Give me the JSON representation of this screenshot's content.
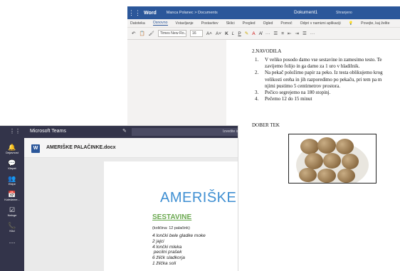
{
  "word": {
    "app_name": "Word",
    "breadcrumb": "Manca Polanec > Documents",
    "doc_title": "Dokument1",
    "save_state": "Shranjeno",
    "tabs": [
      "Datoteka",
      "Osnovno",
      "Vstavljanje",
      "Postavitev",
      "Sklici",
      "Pregled",
      "Ogled",
      "Pomoč",
      "Odpri v namizni aplikaciji",
      "Povejte, kaj želite"
    ],
    "active_tab": "Osnovno",
    "font_name": "Times New Ro...",
    "font_size": "16",
    "section_heading": "2.NAVODILA",
    "steps": [
      {
        "num": "1.",
        "line1": "V veliko posodo damo vse sestavine in zamesimo testo. Te",
        "line2": "zavijemo folijo in ga damo za 1 uro v hladilnik."
      },
      {
        "num": "2.",
        "line1": "Na pekač položimo papir za peko. Iz testa oblikujemo krog",
        "line2": "velikosti oreha in jih razporedimo po pekaču, pri tem pa m",
        "line3": "njimi pustimo 5 centimetrov prostora."
      },
      {
        "num": "3.",
        "line1": "Pečico segrejemo na 180 stopinj."
      },
      {
        "num": "4.",
        "line1": "Pečemo 12 do 15 minut"
      }
    ],
    "closing": "DOBER TEK"
  },
  "teams": {
    "app_name": "Microsoft Teams",
    "search_placeholder": "Izvedite iskanje a",
    "file_name": "AMERIŠKE PALAČINKE.docx",
    "rail": [
      {
        "icon": "bell-icon",
        "glyph": "🔔",
        "label": "Dejavnost"
      },
      {
        "icon": "chat-icon",
        "glyph": "💬",
        "label": "Klepet"
      },
      {
        "icon": "teams-icon",
        "glyph": "👥",
        "label": "Ekipe"
      },
      {
        "icon": "calendar-icon",
        "glyph": "📅",
        "label": "Koledarne..."
      },
      {
        "icon": "tasks-icon",
        "glyph": "☑",
        "label": "Naloge"
      },
      {
        "icon": "calls-icon",
        "glyph": "📞",
        "label": "Klici"
      },
      {
        "icon": "more-icon",
        "glyph": "···",
        "label": ""
      }
    ],
    "doc_title": "AMERIŠKE",
    "ingredients_heading": "SESTAVINE",
    "quantity_note": "(količina: 12 palačink)",
    "ingredients": [
      "4 lončki bele gladke moke",
      "2 jajci",
      "4 lončki mleka",
      " pecilni prašek",
      "6 žličk sladkorja",
      "1 žlička soli"
    ]
  },
  "colors": {
    "word_blue": "#2b579a",
    "teams_purple": "#33344a",
    "title_blue": "#3f8fd2",
    "heading_green": "#6aa84f"
  }
}
